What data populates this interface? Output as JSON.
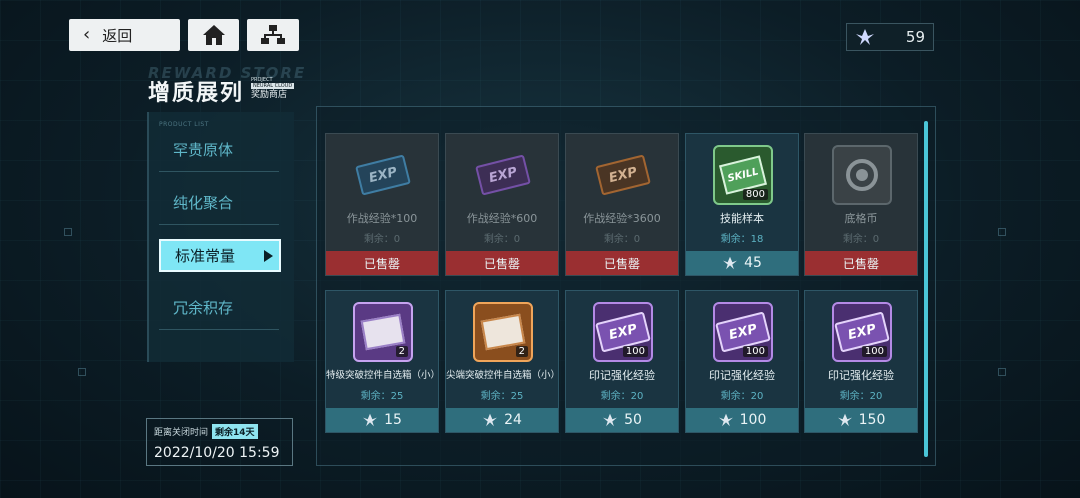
{
  "topbar": {
    "back_label": "返回",
    "currency_value": "59"
  },
  "header": {
    "title": "增质展列",
    "title_ghost": "REWARD STORE",
    "sub_line1": "PROJECT",
    "sub_tag": "NEURAL CLOUD",
    "sub_shop": "奖励商店"
  },
  "menu": {
    "caption": "PRODUCT LIST",
    "items": [
      {
        "label": "罕贵原体"
      },
      {
        "label": "纯化聚合"
      },
      {
        "label": "标准常量"
      },
      {
        "label": "冗余积存"
      }
    ]
  },
  "closing": {
    "label": "距离关闭时间",
    "badge": "剩余14天",
    "date": "2022/10/20 15:59"
  },
  "colors": {
    "accent": "#7fe6f5",
    "sold": "#9a2f31",
    "price_bar": "#2f6e7d"
  },
  "cards": [
    {
      "name": "作战经验*100",
      "remain": "剩余：0",
      "status": "已售罄",
      "icon": "exp-tile-blue",
      "icon_text": "EXP"
    },
    {
      "name": "作战经验*600",
      "remain": "剩余：0",
      "status": "已售罄",
      "icon": "exp-tile-purple",
      "icon_text": "EXP"
    },
    {
      "name": "作战经验*3600",
      "remain": "剩余：0",
      "status": "已售罄",
      "icon": "exp-tile-orange",
      "icon_text": "EXP"
    },
    {
      "name": "技能样本",
      "remain": "剩余：18",
      "price": "45",
      "icon": "skill-sample-icon",
      "icon_text": "SKILL",
      "qty": "800"
    },
    {
      "name": "底格币",
      "remain": "剩余：0",
      "status": "已售罄",
      "icon": "coin-icon"
    },
    {
      "name": "特级突破控件自选箱（小）",
      "remain": "剩余：25",
      "price": "15",
      "icon": "breakthrough-box-purple",
      "qty": "2"
    },
    {
      "name": "尖端突破控件自选箱（小）",
      "remain": "剩余：25",
      "price": "24",
      "icon": "breakthrough-box-orange",
      "qty": "2"
    },
    {
      "name": "印记强化经验",
      "remain": "剩余：20",
      "price": "50",
      "icon": "mark-exp-tile",
      "icon_text": "EXP",
      "qty": "100"
    },
    {
      "name": "印记强化经验",
      "remain": "剩余：20",
      "price": "100",
      "icon": "mark-exp-tile",
      "icon_text": "EXP",
      "qty": "100"
    },
    {
      "name": "印记强化经验",
      "remain": "剩余：20",
      "price": "150",
      "icon": "mark-exp-tile",
      "icon_text": "EXP",
      "qty": "100"
    }
  ]
}
